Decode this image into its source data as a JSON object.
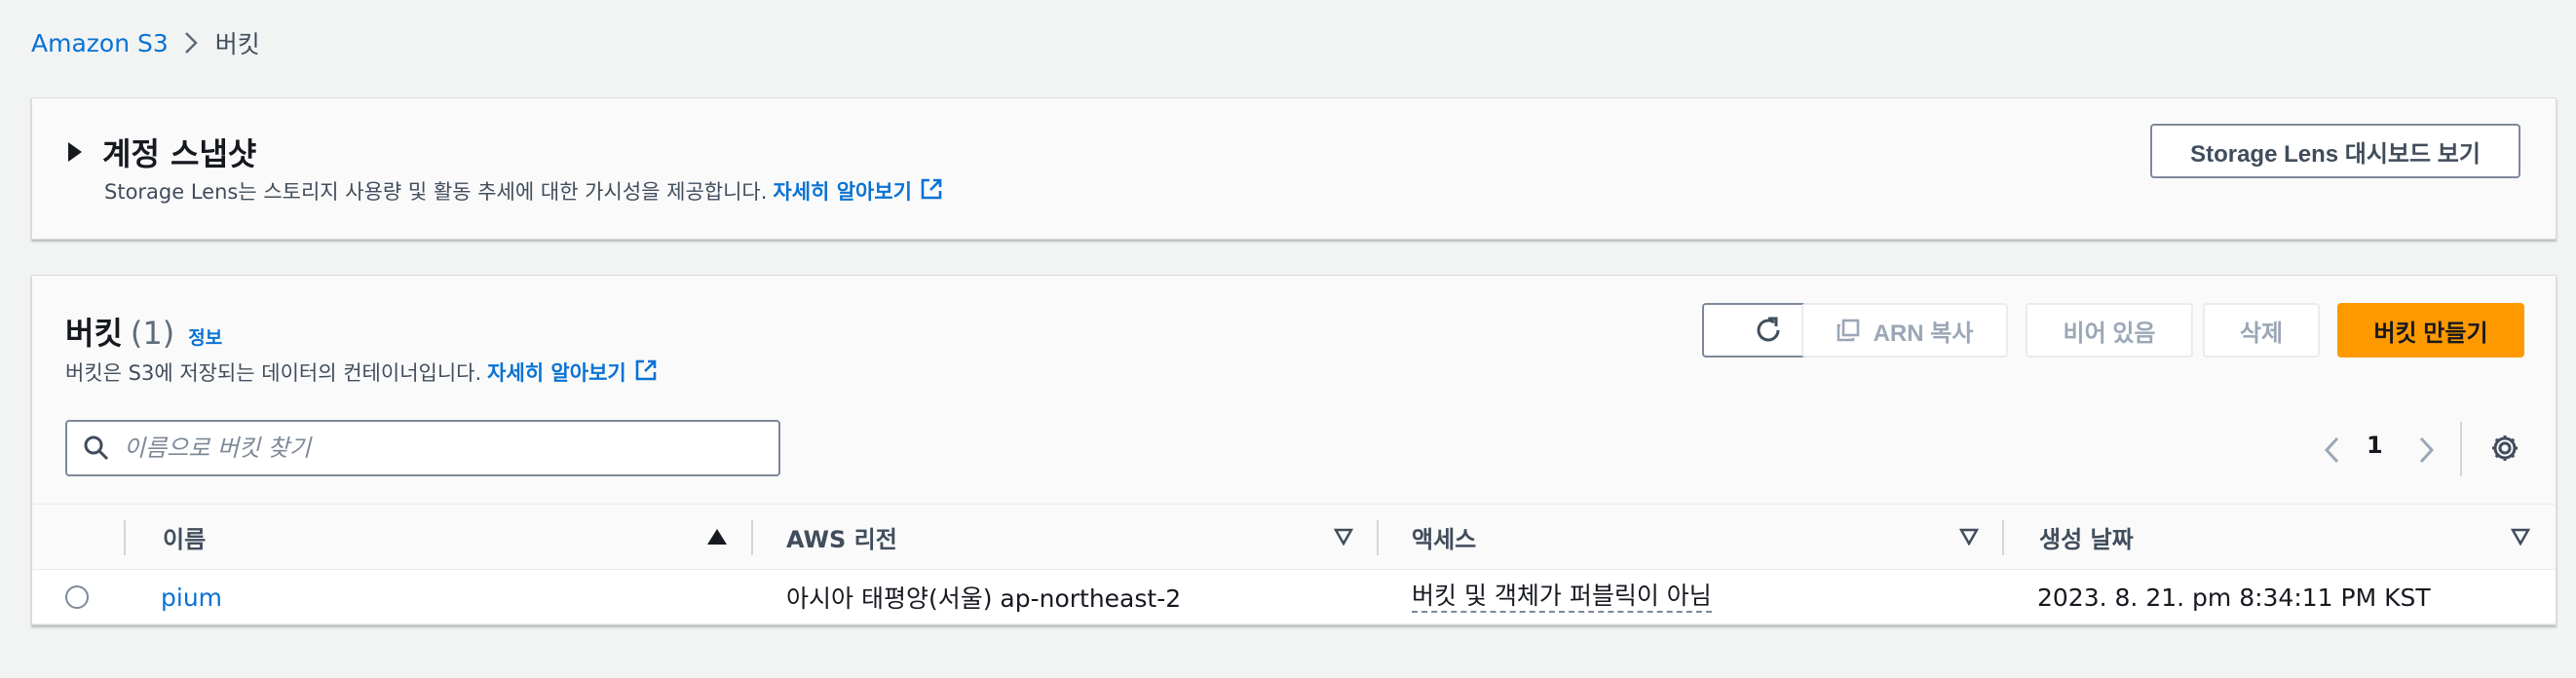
{
  "breadcrumb": {
    "root": "Amazon S3",
    "current": "버킷"
  },
  "snapshot": {
    "title": "계정 스냅샷",
    "description": "Storage Lens는 스토리지 사용량 및 활동 추세에 대한 가시성을 제공합니다.",
    "learn_more": "자세히 알아보기",
    "dashboard_button": "Storage Lens 대시보드 보기"
  },
  "buckets": {
    "title": "버킷",
    "count": "(1)",
    "info": "정보",
    "description": "버킷은 S3에 저장되는 데이터의 컨테이너입니다.",
    "learn_more": "자세히 알아보기",
    "buttons": {
      "copy_arn": "ARN 복사",
      "empty": "비어 있음",
      "delete": "삭제",
      "create": "버킷 만들기"
    },
    "search_placeholder": "이름으로 버킷 찾기",
    "page": "1",
    "columns": {
      "name": "이름",
      "region": "AWS 리전",
      "access": "액세스",
      "created": "생성 날짜"
    },
    "rows": [
      {
        "name": "pium",
        "region": "아시아 태평양(서울) ap-northeast-2",
        "access": "버킷 및 객체가 퍼블릭이 아님",
        "created": "2023. 8. 21. pm 8:34:11 PM KST"
      }
    ]
  },
  "icons": {
    "breadcrumb_separator": "chevron-right-icon",
    "expand": "caret-right-icon",
    "external": "external-link-icon",
    "refresh": "refresh-icon",
    "copy": "copy-icon",
    "search": "search-icon",
    "prev": "chevron-left-icon",
    "next": "chevron-right-icon",
    "settings": "gear-icon",
    "sort_asc": "sort-ascending-icon",
    "sort": "sort-descending-icon"
  },
  "colors": {
    "link": "#0972d3",
    "primary": "#ff9900",
    "background": "#f2f3f3"
  }
}
